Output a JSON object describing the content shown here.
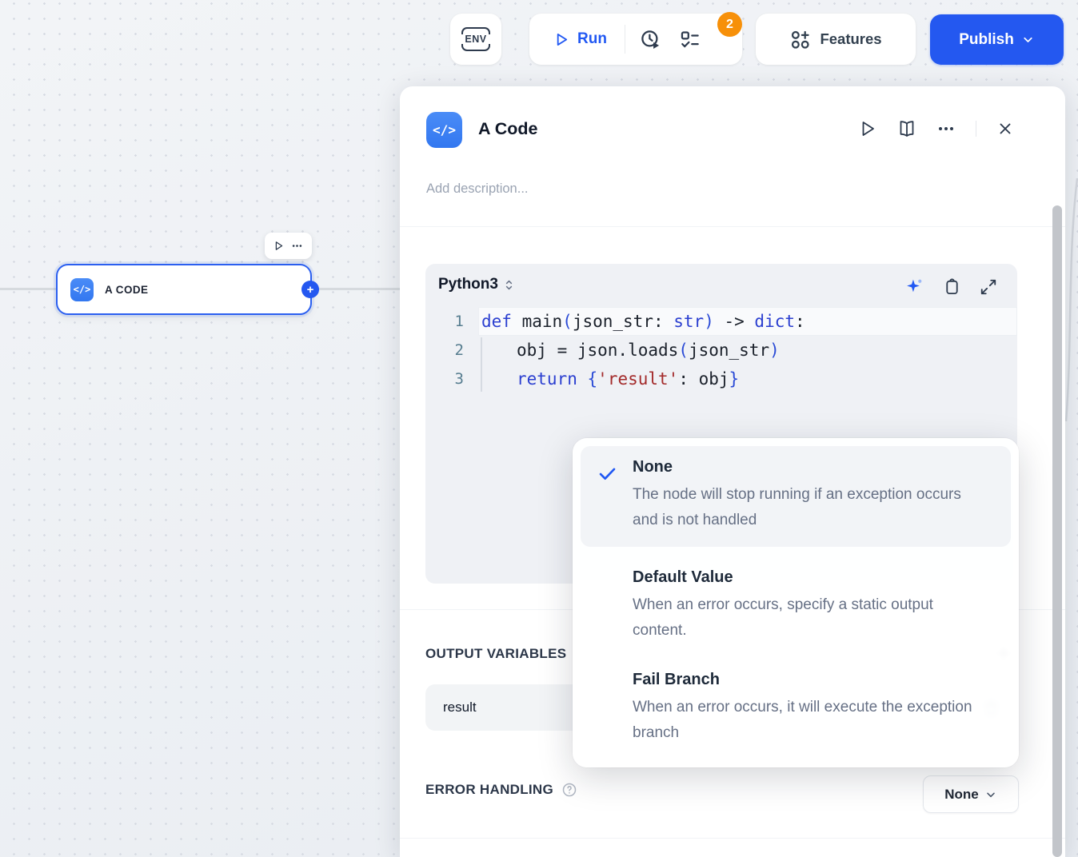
{
  "topbar": {
    "env_label": "ENV",
    "run_label": "Run",
    "history_badge": "2",
    "features_label": "Features",
    "publish_label": "Publish"
  },
  "canvas": {
    "node_title": "A CODE"
  },
  "panel": {
    "title": "A Code",
    "description_placeholder": "Add description...",
    "code": {
      "language": "Python3",
      "lines": [
        {
          "num": "1",
          "tokens": [
            {
              "t": "def ",
              "cls": "tk kw"
            },
            {
              "t": "main",
              "cls": "tk pl"
            },
            {
              "t": "(",
              "cls": "tk br"
            },
            {
              "t": "json_str: ",
              "cls": "tk pl"
            },
            {
              "t": "str",
              "cls": "tk kw"
            },
            {
              "t": ")",
              "cls": "tk br"
            },
            {
              "t": " -> ",
              "cls": "tk pl"
            },
            {
              "t": "dict",
              "cls": "tk kw"
            },
            {
              "t": ":",
              "cls": "tk pl"
            }
          ]
        },
        {
          "num": "2",
          "tokens": [
            {
              "t": "obj = json.loads",
              "cls": "tk pl"
            },
            {
              "t": "(",
              "cls": "tk br"
            },
            {
              "t": "json_str",
              "cls": "tk pl"
            },
            {
              "t": ")",
              "cls": "tk br"
            }
          ]
        },
        {
          "num": "3",
          "tokens": [
            {
              "t": "return ",
              "cls": "tk kw"
            },
            {
              "t": "{",
              "cls": "tk br"
            },
            {
              "t": "'result'",
              "cls": "tk st"
            },
            {
              "t": ": obj",
              "cls": "tk pl"
            },
            {
              "t": "}",
              "cls": "tk br"
            }
          ]
        }
      ]
    },
    "output_variables": {
      "heading": "OUTPUT VARIABLES",
      "variable_name": "result"
    },
    "error_handling": {
      "heading": "ERROR HANDLING",
      "selected_value": "None"
    }
  },
  "dropdown": {
    "options": [
      {
        "title": "None",
        "description": "The node will stop running if an exception occurs and is not handled",
        "selected": true
      },
      {
        "title": "Default Value",
        "description": "When an error occurs, specify a static output content.",
        "selected": false
      },
      {
        "title": "Fail Branch",
        "description": "When an error occurs, it will execute the exception branch",
        "selected": false
      }
    ]
  },
  "colors": {
    "accent_blue": "#2158f3",
    "publish_blue": "#2458f0",
    "node_icon_blue": "#3c83f6",
    "badge_orange": "#f79009",
    "code_keyword_blue": "#2b3fd0",
    "code_string_red": "#a32a2a"
  }
}
